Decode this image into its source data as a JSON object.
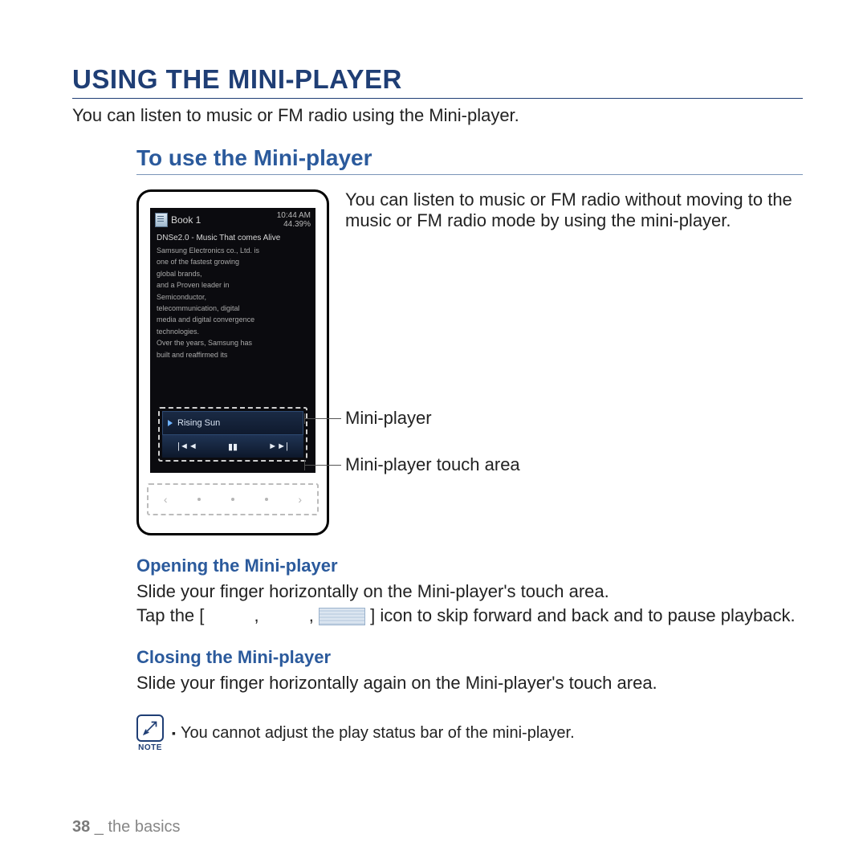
{
  "title": "USING THE MINI-PLAYER",
  "intro": "You can listen to music or FM radio using the Mini-player.",
  "subheading": "To use the Mini-player",
  "annot_para": "You can listen to music or FM radio without moving to the music or FM radio mode by using the mini-player.",
  "annot_mp": "Mini-player",
  "annot_ta": "Mini-player touch area",
  "opening": {
    "heading": "Opening the Mini-player",
    "line1": "Slide your finger horizontally on the Mini-player's touch area.",
    "line2a": "Tap the [",
    "line2b": "] icon to skip forward and back and to pause playback."
  },
  "closing": {
    "heading": "Closing the Mini-player",
    "body": "Slide your finger horizontally again on the Mini-player's touch area."
  },
  "note": {
    "label": "NOTE",
    "text": "You cannot adjust the play status bar of the mini-player."
  },
  "footer": {
    "page": "38",
    "sep": " _ ",
    "chapter": "the basics"
  },
  "device": {
    "book_label": "Book 1",
    "time": "10:44 AM",
    "progress": "44.39%",
    "body_title": "DNSe2.0 - Music That comes Alive",
    "body_lines": [
      "Samsung Electronics co., Ltd. is",
      "one of the fastest growing",
      "global brands,",
      "and a Proven leader in",
      "Semiconductor,",
      "telecommunication, digital",
      "media and digital convergence",
      "technologies.",
      "Over the years, Samsung has",
      "built and reaffirmed its"
    ],
    "track": "Rising Sun",
    "ctrl_prev": "|◄◄",
    "ctrl_pause": "▮▮",
    "ctrl_next": "►►|",
    "touch_left": "‹",
    "touch_right": "›"
  }
}
